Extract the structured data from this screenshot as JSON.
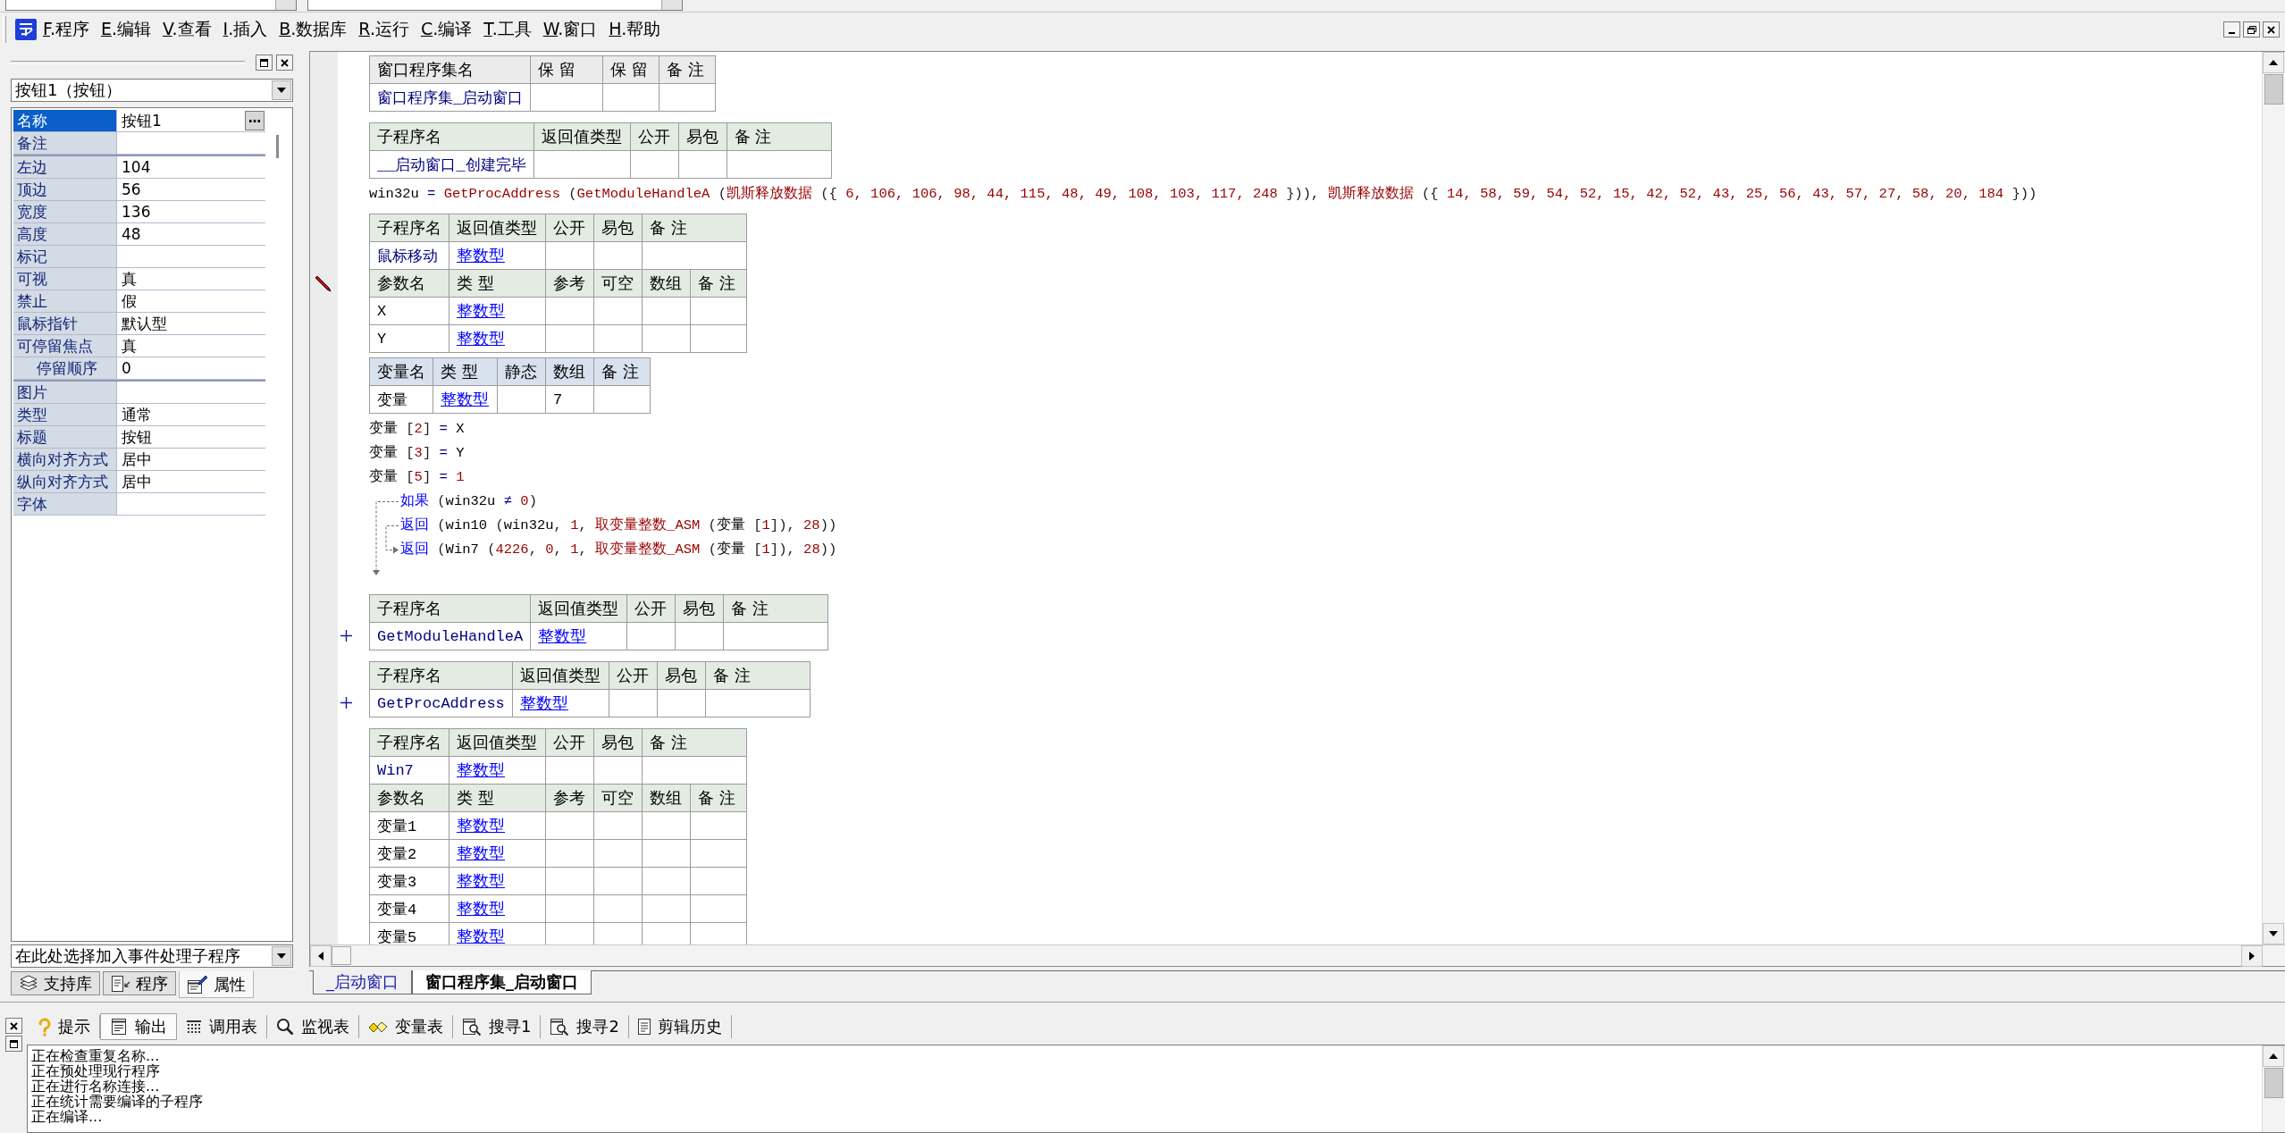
{
  "menu": {
    "items": [
      {
        "mnemonic": "F",
        "label": ".程序"
      },
      {
        "mnemonic": "E",
        "label": ".编辑"
      },
      {
        "mnemonic": "V",
        "label": ".查看"
      },
      {
        "mnemonic": "I",
        "label": ".插入"
      },
      {
        "mnemonic": "B",
        "label": ".数据库"
      },
      {
        "mnemonic": "R",
        "label": ".运行"
      },
      {
        "mnemonic": "C",
        "label": ".编译"
      },
      {
        "mnemonic": "T",
        "label": ".工具"
      },
      {
        "mnemonic": "W",
        "label": ".窗口"
      },
      {
        "mnemonic": "H",
        "label": ".帮助"
      }
    ]
  },
  "property_panel": {
    "object": "按钮1（按钮）",
    "groups": [
      {
        "properties": [
          {
            "name": "名称",
            "value": "按钮1",
            "selected": true
          },
          {
            "name": "备注",
            "selected": false
          }
        ]
      },
      {
        "properties": [
          {
            "name": "左边",
            "value": "104",
            "selected": false
          },
          {
            "name": "顶边",
            "value": "56",
            "selected": false
          },
          {
            "name": "宽度",
            "value": "136",
            "selected": false
          },
          {
            "name": "高度",
            "value": "48",
            "selected": false
          },
          {
            "name": "标记",
            "selected": false
          },
          {
            "name": "可视",
            "value": "真",
            "selected": false
          },
          {
            "name": "禁止",
            "value": "假",
            "selected": false
          },
          {
            "name": "鼠标指针",
            "value": "默认型",
            "selected": false
          },
          {
            "name": "可停留焦点",
            "value": "真",
            "selected": false,
            "children": [
              {
                "name": "停留顺序",
                "value": "0",
                "selected": false
              }
            ]
          }
        ]
      },
      {
        "properties": [
          {
            "name": "图片",
            "selected": false
          },
          {
            "name": "类型",
            "value": "通常",
            "selected": false
          },
          {
            "name": "标题",
            "value": "按钮",
            "selected": false
          },
          {
            "name": "横向对齐方式",
            "value": "居中",
            "selected": false
          },
          {
            "name": "纵向对齐方式",
            "value": "居中",
            "selected": false
          },
          {
            "name": "字体",
            "selected": false
          }
        ]
      }
    ],
    "event_combo": "在此处选择加入事件处理子程序",
    "tabs": [
      {
        "kind": "library",
        "label": "支持库",
        "selected": false
      },
      {
        "kind": "program",
        "label": "程序",
        "selected": false
      },
      {
        "kind": "property",
        "label": "属性",
        "selected": true
      }
    ]
  },
  "editor": {
    "blocks": [
      {
        "kind": "assembly",
        "editing": false,
        "columns": [
          "窗口程序集名",
          "保 留",
          "保 留",
          "备 注"
        ],
        "name": "窗口程序集_启动窗口"
      },
      {
        "kind": "subroutine",
        "editing": false,
        "collapsed": false,
        "columns": [
          "子程序名",
          "返回值类型",
          "公开",
          "易包",
          "备 注"
        ],
        "name": "__启动窗口_创建完毕"
      },
      {
        "kind": "code",
        "editing": false,
        "tokens": [
          {
            "kind": "ident",
            "text": "win32u"
          },
          {
            "kind": "op",
            "text": " = "
          },
          {
            "kind": "func",
            "text": "GetProcAddress"
          },
          {
            "kind": "punct",
            "text": " ("
          },
          {
            "kind": "func",
            "text": "GetModuleHandleA"
          },
          {
            "kind": "punct",
            "text": " ("
          },
          {
            "kind": "func",
            "text": "凯斯释放数据"
          },
          {
            "kind": "punct",
            "text": " ({ "
          },
          {
            "kind": "num",
            "text": "6, 106, 106, 98, 44, 115, 48, 49, 108, 103, 117, 248"
          },
          {
            "kind": "punct",
            "text": " })), "
          },
          {
            "kind": "func",
            "text": "凯斯释放数据"
          },
          {
            "kind": "punct",
            "text": " ({ "
          },
          {
            "kind": "num",
            "text": "14, 58, 59, 54, 52, 15, 42, 52, 43, 25, 56, 43, 57, 27, 58, 20, 184"
          },
          {
            "kind": "punct",
            "text": " }))"
          }
        ]
      },
      {
        "kind": "subroutine",
        "editing": true,
        "collapsed": false,
        "columns": [
          "子程序名",
          "返回值类型",
          "公开",
          "易包",
          "备 注"
        ],
        "name": "鼠标移动",
        "return_type": "整数型",
        "param_columns": [
          "参数名",
          "类 型",
          "参考",
          "可空",
          "数组",
          "备 注"
        ],
        "params": [
          {
            "name": "X",
            "type": "整数型"
          },
          {
            "name": "Y",
            "type": "整数型"
          }
        ]
      },
      {
        "kind": "locals",
        "editing": false,
        "columns": [
          "变量名",
          "类 型",
          "静态",
          "数组",
          "备 注"
        ],
        "vars": [
          {
            "name": "变量",
            "type": "整数型",
            "array": "7"
          }
        ]
      },
      {
        "kind": "code",
        "editing": false,
        "tokens": [
          {
            "kind": "ident",
            "text": "变量"
          },
          {
            "kind": "punct",
            "text": " ["
          },
          {
            "kind": "num",
            "text": "2"
          },
          {
            "kind": "punct",
            "text": "]"
          },
          {
            "kind": "op",
            "text": " = "
          },
          {
            "kind": "ident",
            "text": "X"
          }
        ]
      },
      {
        "kind": "code",
        "editing": false,
        "tokens": [
          {
            "kind": "ident",
            "text": "变量"
          },
          {
            "kind": "punct",
            "text": " ["
          },
          {
            "kind": "num",
            "text": "3"
          },
          {
            "kind": "punct",
            "text": "]"
          },
          {
            "kind": "op",
            "text": " = "
          },
          {
            "kind": "ident",
            "text": "Y"
          }
        ]
      },
      {
        "kind": "code",
        "editing": false,
        "tokens": [
          {
            "kind": "ident",
            "text": "变量"
          },
          {
            "kind": "punct",
            "text": " ["
          },
          {
            "kind": "num",
            "text": "5"
          },
          {
            "kind": "punct",
            "text": "]"
          },
          {
            "kind": "op",
            "text": " = "
          },
          {
            "kind": "num",
            "text": "1"
          }
        ]
      },
      {
        "kind": "if",
        "editing": false,
        "lines": [
          {
            "tokens": [
              {
                "kind": "kw",
                "text": "如果"
              },
              {
                "kind": "punct",
                "text": " ("
              },
              {
                "kind": "ident",
                "text": "win32u"
              },
              {
                "kind": "op",
                "text": " ≠ "
              },
              {
                "kind": "num",
                "text": "0"
              },
              {
                "kind": "punct",
                "text": ")"
              }
            ]
          },
          {
            "tokens": [
              {
                "kind": "kw",
                "text": "返回"
              },
              {
                "kind": "punct",
                "text": " ("
              },
              {
                "kind": "ident",
                "text": "win10"
              },
              {
                "kind": "punct",
                "text": " ("
              },
              {
                "kind": "ident",
                "text": "win32u"
              },
              {
                "kind": "punct",
                "text": ", "
              },
              {
                "kind": "num",
                "text": "1"
              },
              {
                "kind": "punct",
                "text": ", "
              },
              {
                "kind": "func",
                "text": "取变量整数_ASM"
              },
              {
                "kind": "punct",
                "text": " ("
              },
              {
                "kind": "ident",
                "text": "变量"
              },
              {
                "kind": "punct",
                "text": " ["
              },
              {
                "kind": "num",
                "text": "1"
              },
              {
                "kind": "punct",
                "text": "]), "
              },
              {
                "kind": "num",
                "text": "28"
              },
              {
                "kind": "punct",
                "text": "))"
              }
            ]
          },
          {
            "tokens": [
              {
                "kind": "kw",
                "text": "返回"
              },
              {
                "kind": "punct",
                "text": " ("
              },
              {
                "kind": "ident",
                "text": "Win7"
              },
              {
                "kind": "punct",
                "text": " ("
              },
              {
                "kind": "num",
                "text": "4226"
              },
              {
                "kind": "punct",
                "text": ", "
              },
              {
                "kind": "num",
                "text": "0"
              },
              {
                "kind": "punct",
                "text": ", "
              },
              {
                "kind": "num",
                "text": "1"
              },
              {
                "kind": "punct",
                "text": ", "
              },
              {
                "kind": "func",
                "text": "取变量整数_ASM"
              },
              {
                "kind": "punct",
                "text": " ("
              },
              {
                "kind": "ident",
                "text": "变量"
              },
              {
                "kind": "punct",
                "text": " ["
              },
              {
                "kind": "num",
                "text": "1"
              },
              {
                "kind": "punct",
                "text": "]), "
              },
              {
                "kind": "num",
                "text": "28"
              },
              {
                "kind": "punct",
                "text": "))"
              }
            ]
          }
        ]
      },
      {
        "kind": "subroutine",
        "editing": false,
        "collapsed": true,
        "columns": [
          "子程序名",
          "返回值类型",
          "公开",
          "易包",
          "备 注"
        ],
        "name": "GetModuleHandleA",
        "return_type": "整数型"
      },
      {
        "kind": "subroutine",
        "editing": false,
        "collapsed": true,
        "columns": [
          "子程序名",
          "返回值类型",
          "公开",
          "易包",
          "备 注"
        ],
        "name": "GetProcAddress",
        "return_type": "整数型"
      },
      {
        "kind": "subroutine",
        "editing": false,
        "collapsed": false,
        "columns": [
          "子程序名",
          "返回值类型",
          "公开",
          "易包",
          "备 注"
        ],
        "name": "Win7",
        "return_type": "整数型",
        "param_columns": [
          "参数名",
          "类 型",
          "参考",
          "可空",
          "数组",
          "备 注"
        ],
        "params": [
          {
            "name": "变量1",
            "type": "整数型"
          },
          {
            "name": "变量2",
            "type": "整数型"
          },
          {
            "name": "变量3",
            "type": "整数型"
          },
          {
            "name": "变量4",
            "type": "整数型"
          },
          {
            "name": "变量5",
            "type": "整数型"
          }
        ]
      }
    ],
    "tabs": [
      {
        "label": "_启动窗口",
        "selected": false
      },
      {
        "label": "窗口程序集_启动窗口",
        "selected": true
      }
    ]
  },
  "output_panel": {
    "tabs": [
      {
        "kind": "hint",
        "label": "提示",
        "selected": false
      },
      {
        "kind": "output",
        "label": "输出",
        "selected": true
      },
      {
        "kind": "calls",
        "label": "调用表",
        "selected": false
      },
      {
        "kind": "watch",
        "label": "监视表",
        "selected": false
      },
      {
        "kind": "variables",
        "label": "变量表",
        "selected": false
      },
      {
        "kind": "search",
        "label": "搜寻1",
        "selected": false
      },
      {
        "kind": "search",
        "label": "搜寻2",
        "selected": false
      },
      {
        "kind": "clipboard",
        "label": "剪辑历史",
        "selected": false
      }
    ],
    "lines": [
      "正在检查重复名称...",
      "正在预处理现行程序",
      "正在进行名称连接...",
      "正在统计需要编译的子程序",
      "正在编译..."
    ]
  }
}
